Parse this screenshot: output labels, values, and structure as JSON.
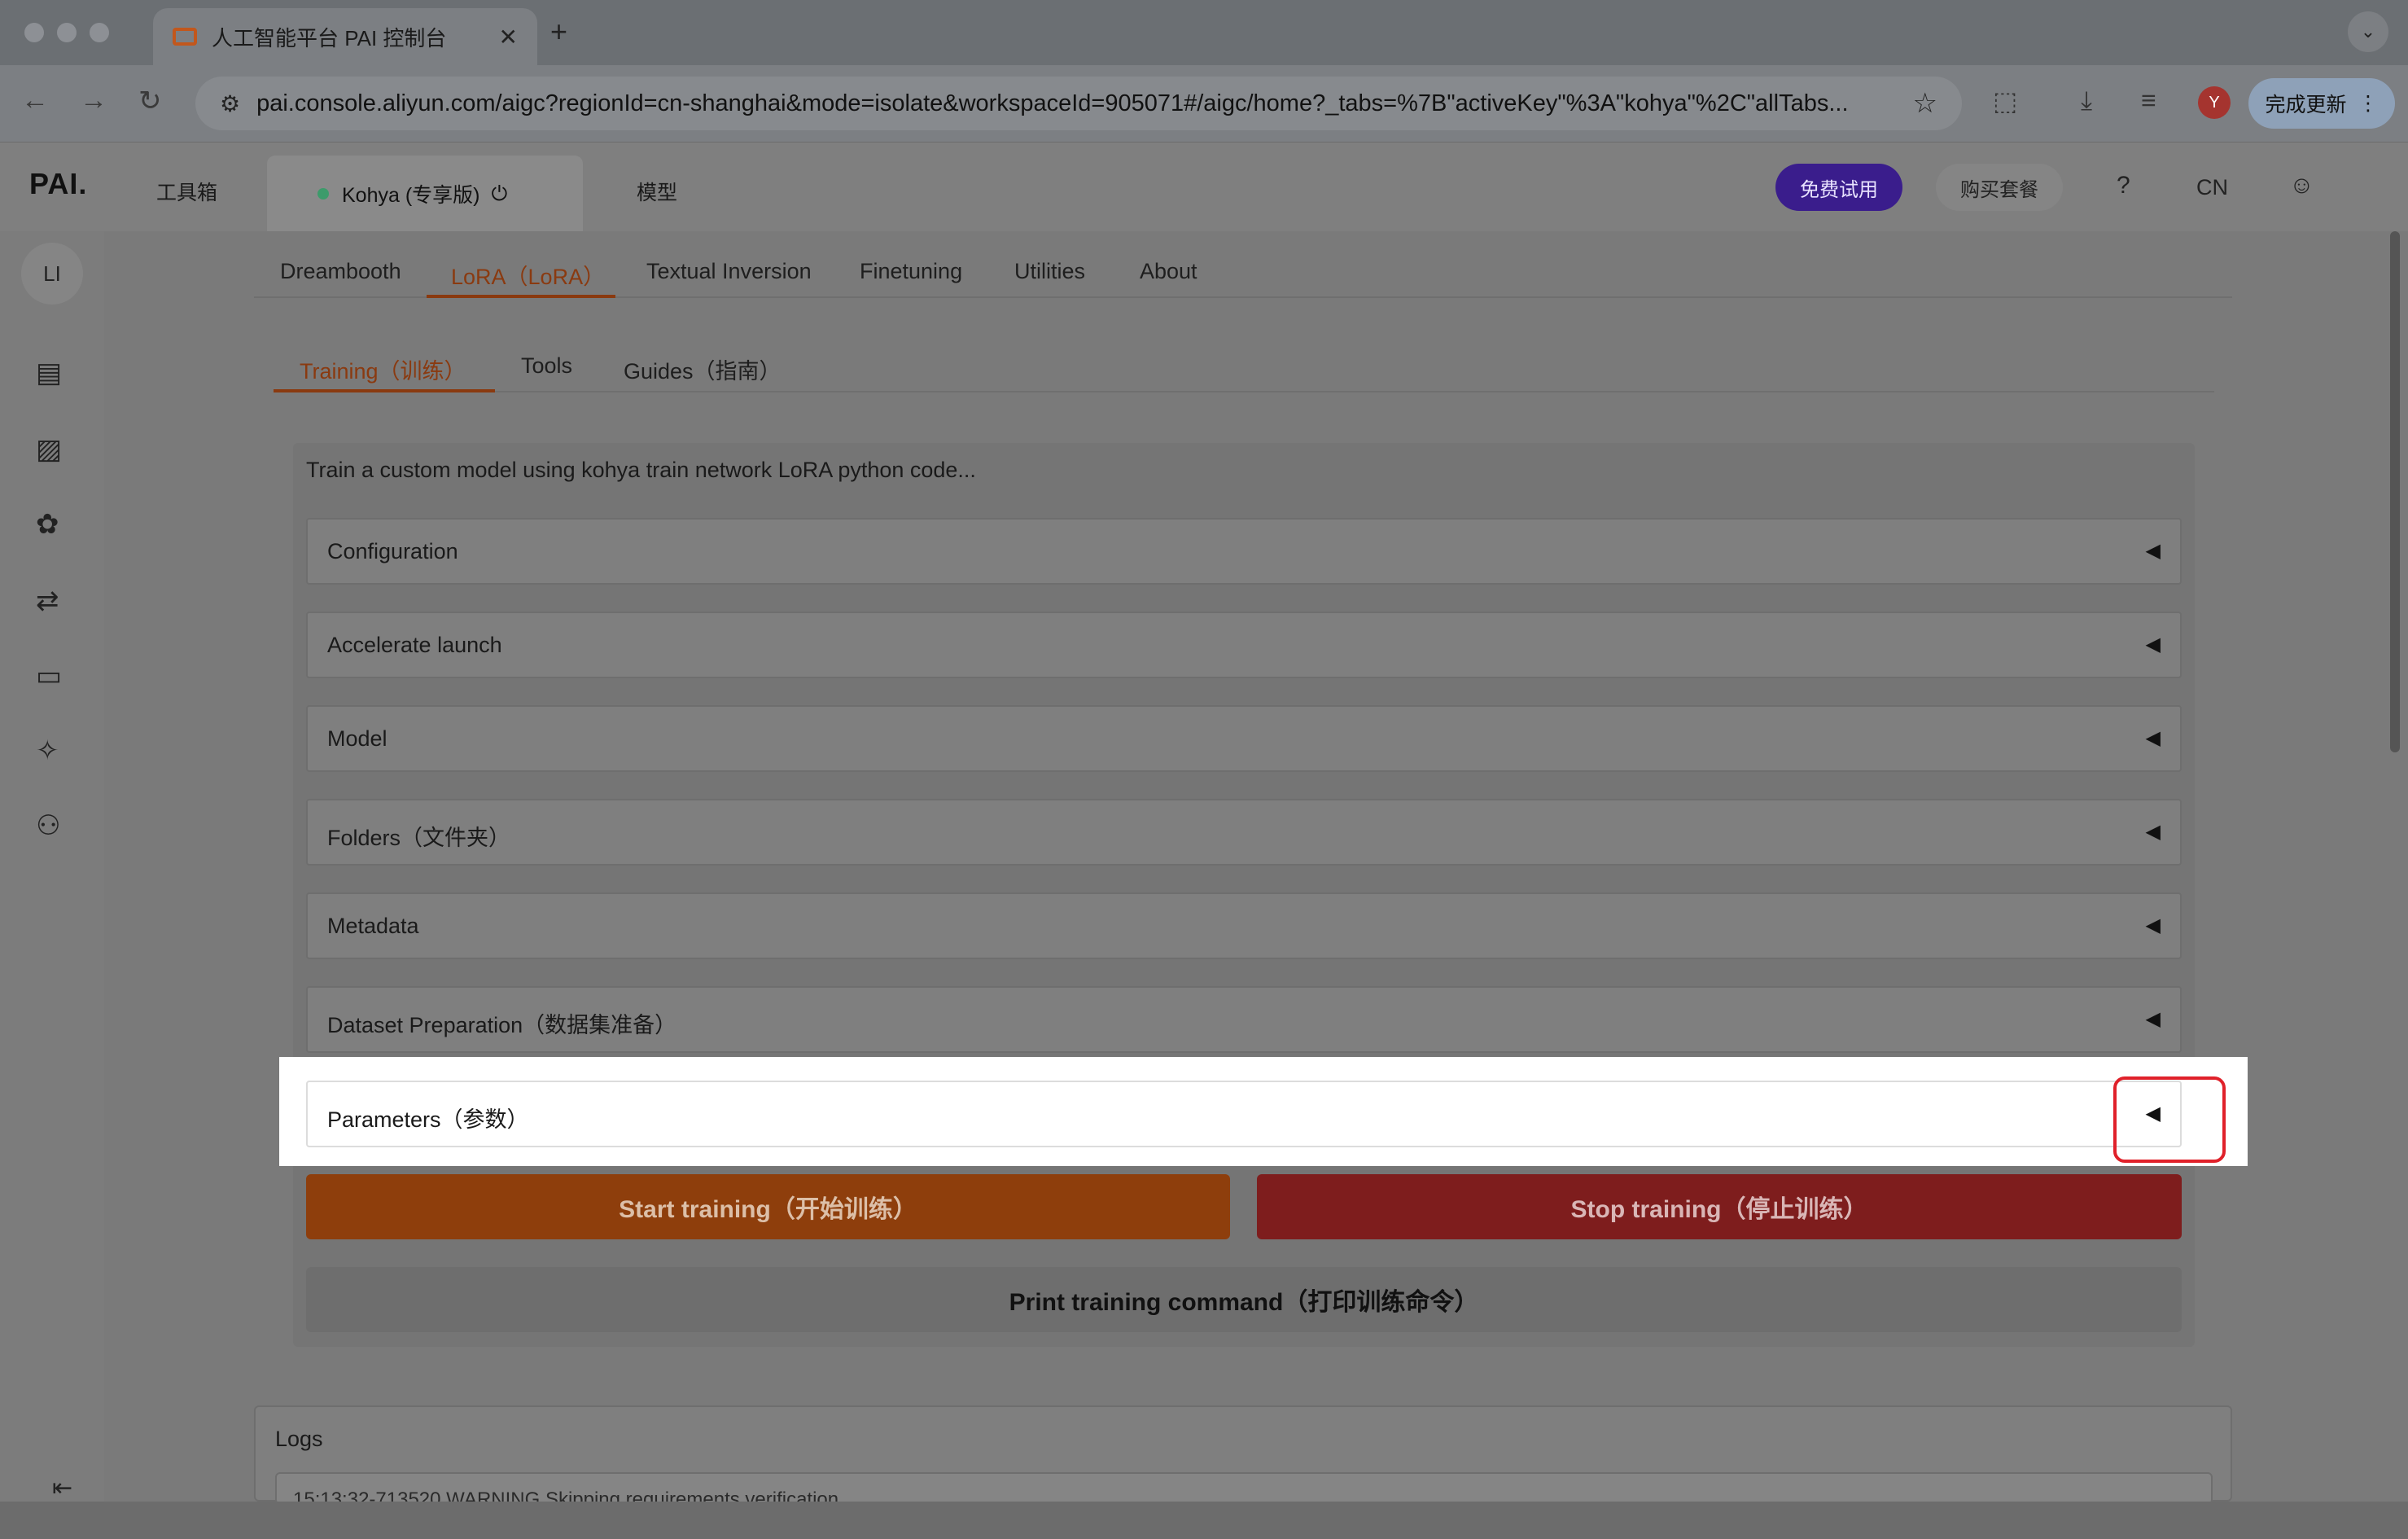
{
  "browser": {
    "tab_title": "人工智能平台 PAI 控制台",
    "tab_close": "✕",
    "new_tab": "+",
    "tab_menu": "⌄",
    "url": "pai.console.aliyun.com/aigc?regionId=cn-shanghai&mode=isolate&workspaceId=905071#/aigc/home?_tabs=%7B\"activeKey\"%3A\"kohya\"%2C\"allTabs...",
    "profile_initial": "Y",
    "update_label": "完成更新",
    "icons": [
      "back-icon",
      "forward-icon",
      "reload-icon",
      "site-settings-icon",
      "star-icon",
      "extensions-icon",
      "download-icon",
      "media-icon",
      "profile-icon",
      "more-icon"
    ]
  },
  "app": {
    "logo": "PAI.",
    "nav_toolbox": "工具箱",
    "active_tab": "Kohya (专享版)",
    "nav_models": "模型",
    "free_trial": "免费试用",
    "buy_plan": "购买套餐",
    "lang": "CN",
    "rail_avatar": "LI",
    "colors": {
      "accent": "#c2571c",
      "free_trial_bg": "#4a2ab5",
      "start": "#c25a12",
      "stop": "#b82a2a",
      "highlight_border": "#e0212a"
    }
  },
  "tabs_primary": [
    "Dreambooth",
    "LoRA（LoRA）",
    "Textual Inversion",
    "Finetuning",
    "Utilities",
    "About"
  ],
  "tabs_secondary": [
    "Training（训练）",
    "Tools",
    "Guides（指南）"
  ],
  "training": {
    "description": "Train a custom model using kohya train network LoRA python code...",
    "sections": [
      "Configuration",
      "Accelerate launch",
      "Model",
      "Folders（文件夹）",
      "Metadata",
      "Dataset Preparation（数据集准备）",
      "Parameters（参数）"
    ],
    "caret": "◀",
    "start": "Start training（开始训练）",
    "stop": "Stop training（停止训练）",
    "print": "Print training command（打印训练命令）"
  },
  "logs": {
    "label": "Logs",
    "line": "15:13:32-713520 WARNING Skipping requirements verification."
  }
}
